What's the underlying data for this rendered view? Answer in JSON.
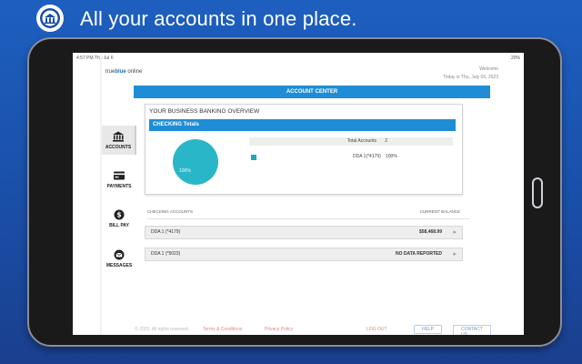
{
  "banner": {
    "title": "All your accounts in one place."
  },
  "status": {
    "time": "4:57 PM   Thu Jul 6",
    "battery": "20%"
  },
  "header": {
    "brand_prefix": "true",
    "brand_mid": "blue",
    "brand_suffix": " online",
    "welcome": "Welcome",
    "date": "Today is Thu, July 06, 2023"
  },
  "sidebar": {
    "items": [
      {
        "label": "ACCOUNTS",
        "icon": "bank-icon"
      },
      {
        "label": "PAYMENTS",
        "icon": "card-icon"
      },
      {
        "label": "BILL PAY",
        "icon": "dollar-icon"
      },
      {
        "label": "MESSAGES",
        "icon": "envelope-icon"
      }
    ]
  },
  "main": {
    "account_center": "ACCOUNT CENTER",
    "overview_title": "YOUR BUSINESS BANKING OVERVIEW",
    "checking_title": "CHECKING Totals",
    "pie_label": "100%",
    "total_accounts_label": "Total Accounts",
    "total_accounts_value": "2",
    "legend_name": "DDA 1(*4179)",
    "legend_pct": "100%",
    "accounts_header": "CHECKING ACCOUNTS",
    "balance_header": "CURRENT BALANCE",
    "accounts": [
      {
        "name": "DDA 1 (*4179)",
        "balance": "$58,468.99"
      },
      {
        "name": "DDA 1 (*5023)",
        "balance": "NO DATA REPORTED"
      }
    ]
  },
  "footer": {
    "copyright": "© 2023. All rights reserved.",
    "terms": "Terms & Conditions",
    "privacy": "Privacy Policy",
    "logout": "LOG OUT",
    "help": "HELP",
    "contact": "CONTACT US"
  },
  "colors": {
    "accent": "#1f8dd6",
    "pie": "#29b6c8",
    "background": "#1d5fbf"
  }
}
